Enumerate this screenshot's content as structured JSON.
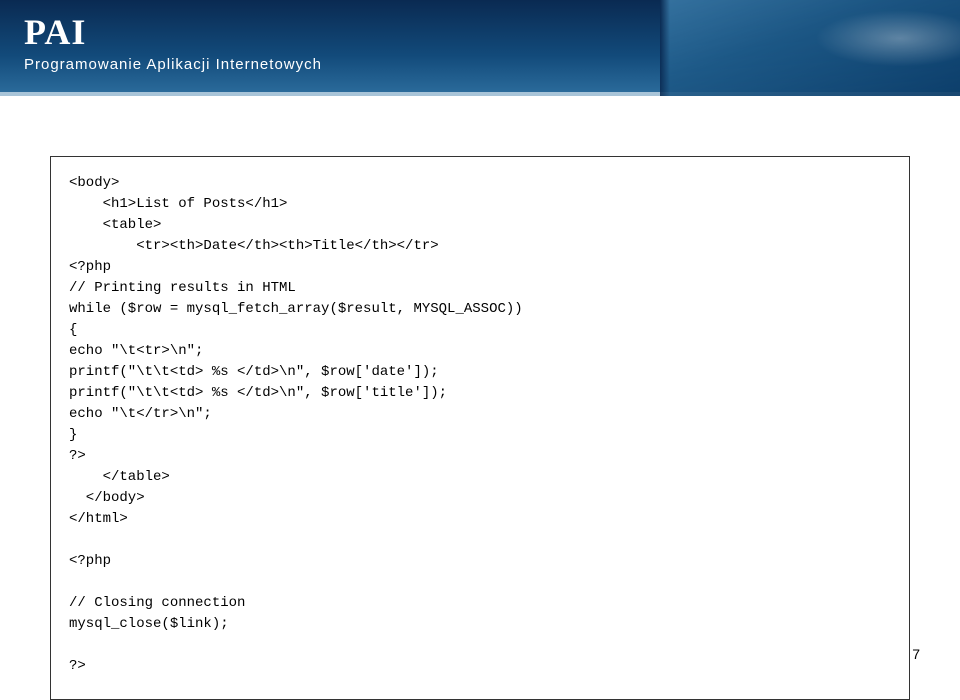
{
  "header": {
    "title": "PAI",
    "subtitle": "Programowanie Aplikacji Internetowych"
  },
  "code": {
    "text": "<body>\n    <h1>List of Posts</h1>\n    <table>\n        <tr><th>Date</th><th>Title</th></tr>\n<?php\n// Printing results in HTML\nwhile ($row = mysql_fetch_array($result, MYSQL_ASSOC))\n{\necho \"\\t<tr>\\n\";\nprintf(\"\\t\\t<td> %s </td>\\n\", $row['date']);\nprintf(\"\\t\\t<td> %s </td>\\n\", $row['title']);\necho \"\\t</tr>\\n\";\n}\n?>\n    </table>\n  </body>\n</html>\n\n<?php\n\n// Closing connection\nmysql_close($link);\n\n?>"
  },
  "page": {
    "number": "7"
  }
}
